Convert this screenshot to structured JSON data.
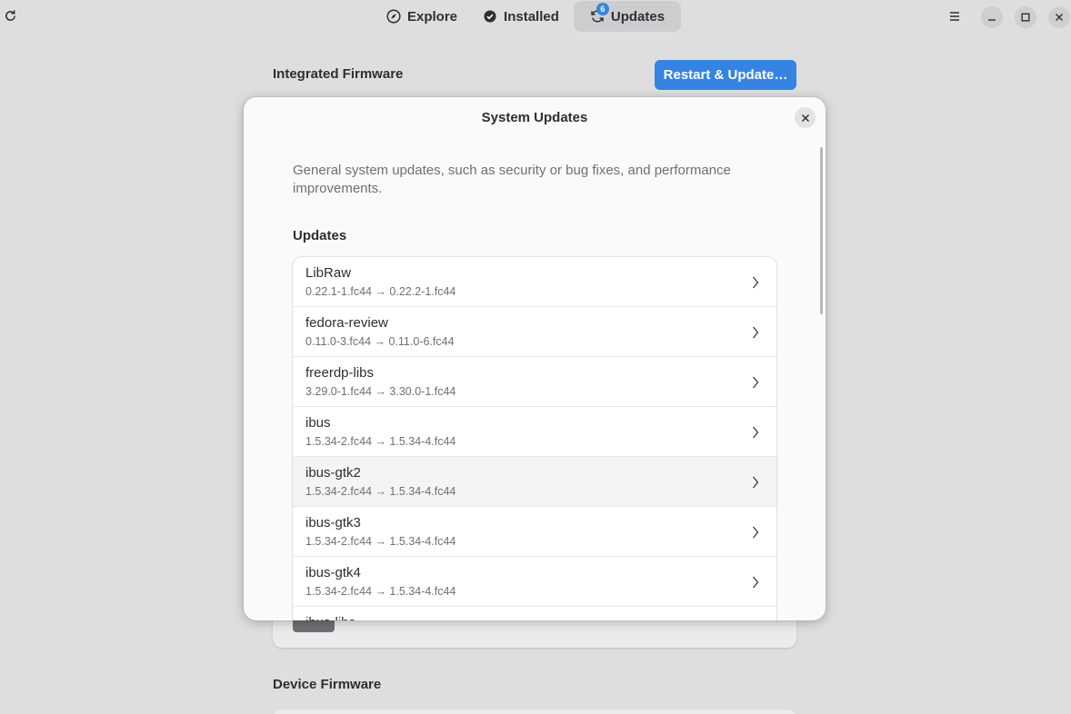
{
  "header": {
    "refresh_icon": "refresh-icon",
    "tabs": [
      {
        "label": "Explore",
        "icon": "compass-icon"
      },
      {
        "label": "Installed",
        "icon": "check-circle-icon"
      },
      {
        "label": "Updates",
        "icon": "sync-icon",
        "badge": "6"
      }
    ],
    "menu_icon": "hamburger-menu-icon",
    "window_controls": [
      "minimize-icon",
      "maximize-icon",
      "close-icon"
    ]
  },
  "background": {
    "integrated_firmware_title": "Integrated Firmware",
    "restart_button": "Restart & Update…",
    "device_firmware_title": "Device Firmware"
  },
  "dialog": {
    "title": "System Updates",
    "description": "General system updates, such as security or bug fixes, and performance improvements.",
    "updates_heading": "Updates",
    "items": [
      {
        "name": "LibRaw",
        "version": "0.22.1-1.fc44 → 0.22.2-1.fc44"
      },
      {
        "name": "fedora-review",
        "version": "0.11.0-3.fc44 → 0.11.0-6.fc44"
      },
      {
        "name": "freerdp-libs",
        "version": "3.29.0-1.fc44 → 3.30.0-1.fc44"
      },
      {
        "name": "ibus",
        "version": "1.5.34-2.fc44 → 1.5.34-4.fc44"
      },
      {
        "name": "ibus-gtk2",
        "version": "1.5.34-2.fc44 → 1.5.34-4.fc44"
      },
      {
        "name": "ibus-gtk3",
        "version": "1.5.34-2.fc44 → 1.5.34-4.fc44"
      },
      {
        "name": "ibus-gtk4",
        "version": "1.5.34-2.fc44 → 1.5.34-4.fc44"
      },
      {
        "name": "ibus-libs",
        "version": ""
      }
    ]
  },
  "colors": {
    "accent": "#3584e4",
    "window_bg": "#dededf",
    "dialog_bg": "#fafafb"
  }
}
